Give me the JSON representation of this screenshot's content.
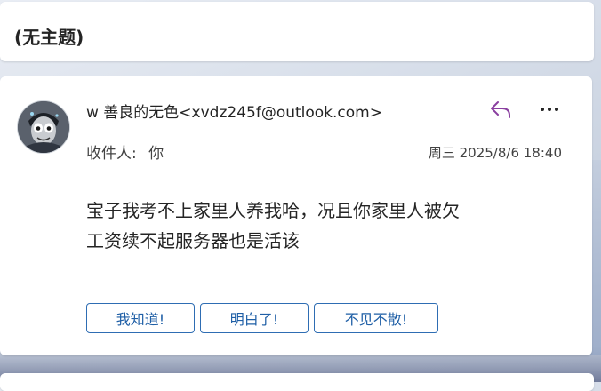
{
  "email": {
    "subject": "(无主题)",
    "sender": "w 善良的无色<xvdz245f@outlook.com>",
    "recipient_label": "收件人:",
    "recipient": "你",
    "datetime": "周三 2025/8/6 18:40",
    "body_lines": [
      "宝子我考不上家里人养我哈，况且你家里人被欠",
      "工资续不起服务器也是活该"
    ],
    "quick_replies": [
      "我知道!",
      "明白了!",
      "不见不散!"
    ]
  },
  "icons": {
    "reply": "reply-arrow-icon",
    "more": "more-dots-icon",
    "avatar": "avatar-image"
  },
  "colors": {
    "reply_icon": "#8a3fa0",
    "quick_reply_border": "#2e6db3",
    "quick_reply_text": "#1f5fa6"
  }
}
